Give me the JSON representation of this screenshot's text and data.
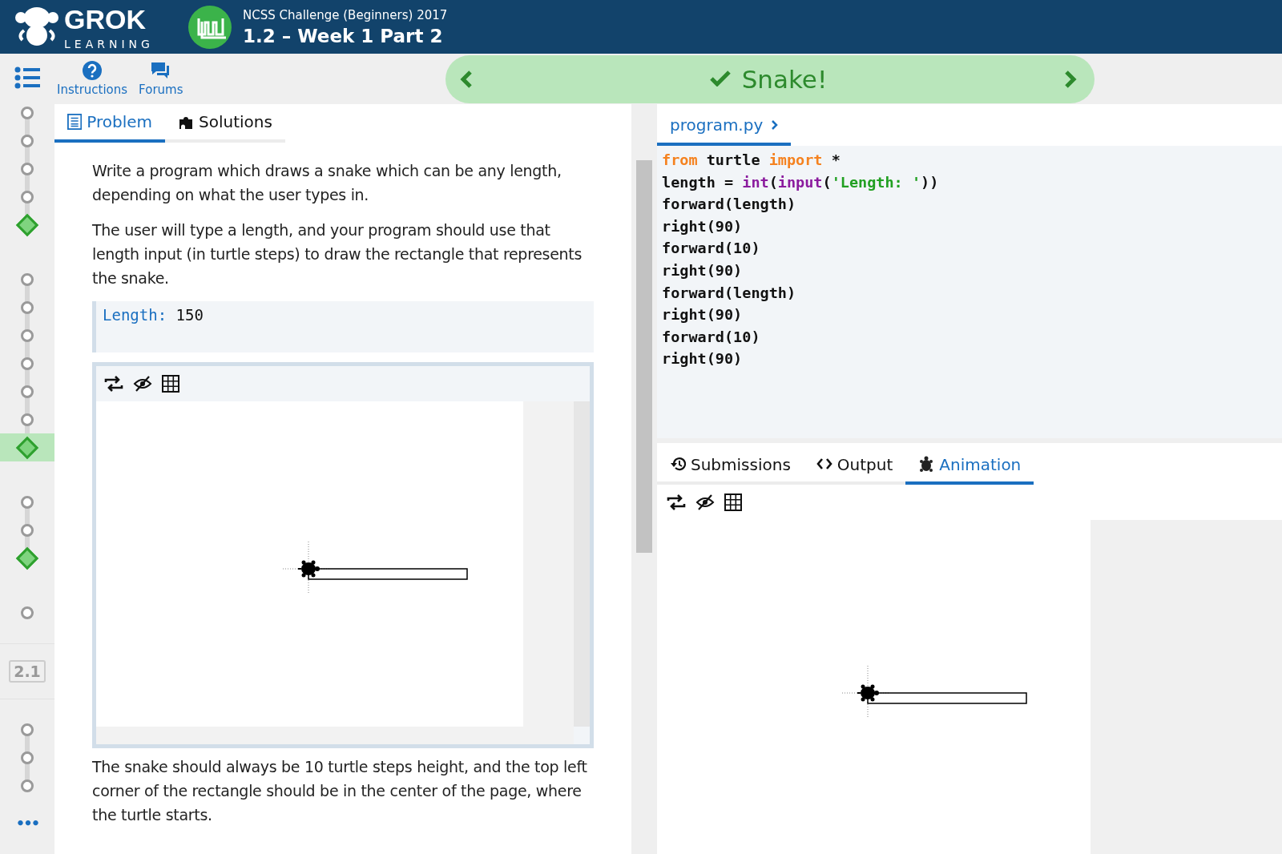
{
  "header": {
    "logo_word": "GROK",
    "logo_sub": "LEARNING",
    "course": "NCSS Challenge (Beginners) 2017",
    "module": "1.2 – Week 1 Part 2"
  },
  "nav": [
    {
      "label": "Instructions",
      "kind": "help"
    },
    {
      "label": "Forums",
      "kind": "forum"
    }
  ],
  "banner": {
    "title": "Snake!",
    "solved": true
  },
  "rail": {
    "groups": [
      {
        "steps": [
          {
            "done": false,
            "selected": false
          },
          {
            "done": false,
            "selected": false
          },
          {
            "done": false,
            "selected": false
          },
          {
            "done": false,
            "selected": false
          },
          {
            "done": true,
            "selected": false
          }
        ]
      },
      {
        "steps": [
          {
            "done": false,
            "selected": false
          },
          {
            "done": false,
            "selected": false
          },
          {
            "done": false,
            "selected": false
          },
          {
            "done": false,
            "selected": false
          },
          {
            "done": false,
            "selected": false
          },
          {
            "done": false,
            "selected": false
          },
          {
            "done": true,
            "selected": true
          }
        ]
      },
      {
        "steps": [
          {
            "done": false,
            "selected": false
          },
          {
            "done": false,
            "selected": false
          },
          {
            "done": true,
            "selected": false
          }
        ]
      },
      {
        "steps": [
          {
            "done": false,
            "selected": false
          }
        ]
      }
    ],
    "label": "2.1",
    "after": [
      {
        "done": false,
        "selected": false
      },
      {
        "done": false,
        "selected": false
      },
      {
        "done": false,
        "selected": false
      }
    ],
    "more": "•••"
  },
  "problem_tabs": [
    {
      "label": "Problem",
      "kind": "doc",
      "selected": true
    },
    {
      "label": "Solutions",
      "kind": "puzzle",
      "selected": false
    }
  ],
  "problem": {
    "paragraphs": [
      "Write a program which draws a snake which can be any length, depending on what the user types in.",
      "The user will type a length, and your program should use that length input (in turtle steps) to draw the rectangle that represents the snake."
    ],
    "example": {
      "prompt": "Length:",
      "input": "150"
    },
    "after": "The snake should always be 10 turtle steps height, and the top left corner of the rectangle should be in the center of the page, where the turtle starts."
  },
  "editor": {
    "file": "program.py",
    "lines": [
      [
        {
          "text": "from",
          "kind": "keyword"
        },
        {
          "text": " turtle ",
          "kind": "plain"
        },
        {
          "text": "import",
          "kind": "keyword"
        },
        {
          "text": " *",
          "kind": "plain"
        }
      ],
      [
        {
          "text": "length = ",
          "kind": "plain"
        },
        {
          "text": "int",
          "kind": "builtin"
        },
        {
          "text": "(",
          "kind": "plain"
        },
        {
          "text": "input",
          "kind": "builtin"
        },
        {
          "text": "(",
          "kind": "plain"
        },
        {
          "text": "'Length: '",
          "kind": "string"
        },
        {
          "text": "))",
          "kind": "plain"
        }
      ],
      [
        {
          "text": "forward(length)",
          "kind": "plain"
        }
      ],
      [
        {
          "text": "right(90)",
          "kind": "plain"
        }
      ],
      [
        {
          "text": "forward(10)",
          "kind": "plain"
        }
      ],
      [
        {
          "text": "right(90)",
          "kind": "plain"
        }
      ],
      [
        {
          "text": "forward(length)",
          "kind": "plain"
        }
      ],
      [
        {
          "text": "right(90)",
          "kind": "plain"
        }
      ],
      [
        {
          "text": "forward(10)",
          "kind": "plain"
        }
      ],
      [
        {
          "text": "right(90)",
          "kind": "plain"
        }
      ]
    ]
  },
  "output_tabs": [
    {
      "label": "Submissions",
      "kind": "history",
      "selected": false
    },
    {
      "label": "Output",
      "kind": "code",
      "selected": false
    },
    {
      "label": "Animation",
      "kind": "turtle",
      "selected": true
    }
  ]
}
